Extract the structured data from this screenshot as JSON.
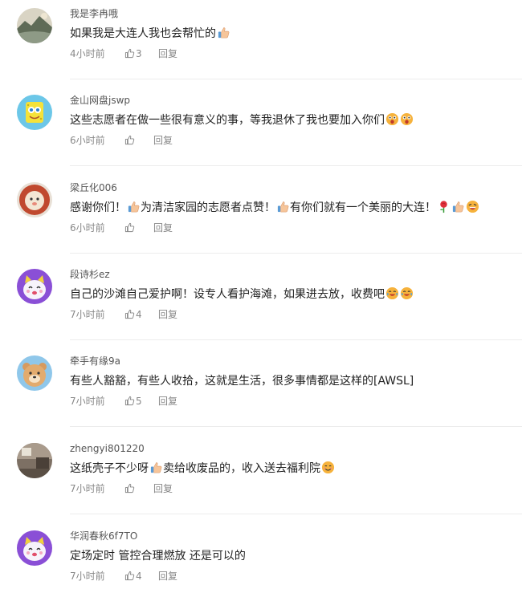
{
  "comments": [
    {
      "username": "我是李冉哦",
      "seg1": "如果我是大连人我也会帮忙的",
      "seg2": "",
      "seg3": "",
      "seg4": "",
      "time": "4小时前",
      "likes": "3",
      "reply_label": "回复",
      "avatar_icon": "landscape-avatar-icon"
    },
    {
      "username": "金山网盘jswp",
      "seg1": "这些志愿者在做一些很有意义的事，等我退休了我也要加入你们",
      "seg2": "",
      "seg3": "",
      "seg4": "",
      "time": "6小时前",
      "likes": "",
      "reply_label": "回复",
      "avatar_icon": "sponge-cartoon-avatar-icon"
    },
    {
      "username": "梁丘化006",
      "seg1": "感谢你们！",
      "seg2": "为清洁家园的志愿者点赞！",
      "seg3": "有你们就有一个美丽的大连！",
      "seg4": "",
      "time": "6小时前",
      "likes": "",
      "reply_label": "回复",
      "avatar_icon": "lion-cartoon-avatar-icon"
    },
    {
      "username": "段诗杉ez",
      "seg1": "自己的沙滩自己爱护啊！设专人看护海滩，如果进去放，收费吧",
      "seg2": "",
      "seg3": "",
      "seg4": "",
      "time": "7小时前",
      "likes": "4",
      "reply_label": "回复",
      "avatar_icon": "purple-cat-avatar-icon"
    },
    {
      "username": "牵手有缘9a",
      "seg1": "有些人豁豁，有些人收拾，这就是生活，很多事情都是这样的[AWSL]",
      "seg2": "",
      "seg3": "",
      "seg4": "",
      "time": "7小时前",
      "likes": "5",
      "reply_label": "回复",
      "avatar_icon": "bear-cartoon-avatar-icon"
    },
    {
      "username": "zhengyi801220",
      "seg1": "这纸壳子不少呀",
      "seg2": "卖给收废品的，收入送去福利院",
      "seg3": "",
      "seg4": "",
      "time": "7小时前",
      "likes": "",
      "reply_label": "回复",
      "avatar_icon": "room-photo-avatar-icon"
    },
    {
      "username": "华润春秋6f7TO",
      "seg1": "定场定时 管控合理燃放 还是可以的",
      "seg2": "",
      "seg3": "",
      "seg4": "",
      "time": "7小时前",
      "likes": "4",
      "reply_label": "回复",
      "avatar_icon": "purple-cat-avatar-icon"
    }
  ],
  "icons": {
    "like": "thumbs-up-icon",
    "emoji_thumbs": "thumbs-up-emoji-icon",
    "emoji_surprised": "surprised-face-emoji-icon",
    "emoji_rose": "rose-emoji-icon",
    "emoji_laugh": "laughing-face-emoji-icon",
    "emoji_smile": "smiling-face-emoji-icon",
    "emoji_cry_laugh": "crying-laughing-emoji-icon"
  },
  "colors": {
    "username": "#555555",
    "text": "#222222",
    "meta": "#888888",
    "divider": "#ececec"
  }
}
